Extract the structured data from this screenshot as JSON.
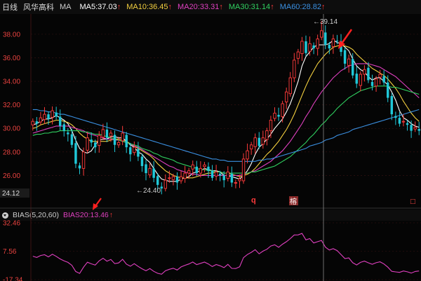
{
  "header": {
    "period": "日线",
    "stock_name": "风华高科",
    "indicator": "MA",
    "ma": [
      {
        "label": "MA5:37.03",
        "color": "#ffffff"
      },
      {
        "label": "MA10:36.45",
        "color": "#f4d03f"
      },
      {
        "label": "MA20:33.31",
        "color": "#e040c0"
      },
      {
        "label": "MA30:31.14",
        "color": "#30d060"
      },
      {
        "label": "MA60:28.82",
        "color": "#3a8fe0"
      }
    ],
    "up_arrow": "↑"
  },
  "sub_header": {
    "indicator": "BIAS(5,20,60)",
    "value": "BIAS20:13.46",
    "color": "#e040c0"
  },
  "annotations": {
    "high_label": "39.14",
    "low_label": "24.40",
    "low_axis_value": "24.12",
    "marker_q": "q",
    "marker_rong": "榕",
    "marker_box": "□"
  },
  "colors": {
    "up": "#ff3b3b",
    "down": "#20c8d8",
    "grid": "#3a1414",
    "axis": "#e8423f"
  },
  "chart_data": [
    {
      "type": "candlestick",
      "ylim": [
        24.12,
        39.6
      ],
      "yticks": [
        38.0,
        36.0,
        34.0,
        32.0,
        30.0,
        28.0,
        26.0
      ],
      "high": 39.14,
      "low": 24.4,
      "close": [
        30.6,
        30.4,
        30.9,
        31.2,
        30.8,
        31.5,
        31.0,
        30.2,
        29.8,
        29.5,
        28.6,
        27.0,
        26.6,
        28.0,
        29.2,
        28.8,
        28.4,
        29.4,
        29.9,
        29.2,
        29.6,
        28.6,
        28.8,
        29.6,
        28.4,
        27.8,
        28.4,
        27.6,
        26.8,
        26.2,
        26.6,
        25.8,
        25.2,
        24.9,
        25.6,
        25.8,
        25.9,
        25.4,
        25.9,
        26.2,
        26.4,
        26.9,
        26.2,
        26.6,
        26.9,
        26.4,
        25.8,
        26.3,
        26.0,
        25.6,
        26.3,
        25.4,
        25.4,
        25.7,
        27.4,
        28.1,
        28.6,
        29.2,
        28.5,
        29.2,
        29.8,
        30.7,
        31.3,
        31.0,
        32.1,
        33.1,
        34.3,
        35.8,
        36.5,
        37.4,
        36.4,
        37.2,
        36.8,
        37.6,
        38.3,
        37.1,
        36.8,
        37.6,
        37.4,
        36.5,
        35.5,
        35.9,
        34.5,
        33.8,
        34.6,
        35.0,
        34.1,
        33.6,
        34.2,
        34.6,
        33.9,
        32.6,
        31.2,
        30.9,
        30.4,
        30.6,
        30.3,
        29.8,
        30.1,
        29.8
      ],
      "series": [
        {
          "name": "MA5",
          "color": "#ffffff",
          "values": [
            30.3,
            30.4,
            30.6,
            30.8,
            30.8,
            30.9,
            31.1,
            30.9,
            30.7,
            30.4,
            29.8,
            29.0,
            28.3,
            28.0,
            27.9,
            28.1,
            28.6,
            29.0,
            29.1,
            29.1,
            29.3,
            29.3,
            29.2,
            29.2,
            28.9,
            28.6,
            28.4,
            28.0,
            27.8,
            27.4,
            27.1,
            26.6,
            26.1,
            25.7,
            25.6,
            25.5,
            25.5,
            25.5,
            25.7,
            25.8,
            25.9,
            26.2,
            26.3,
            26.4,
            26.6,
            26.5,
            26.4,
            26.4,
            26.3,
            26.0,
            26.0,
            25.9,
            25.8,
            25.7,
            26.0,
            26.4,
            27.0,
            27.8,
            28.4,
            28.7,
            29.1,
            29.5,
            30.0,
            30.4,
            30.8,
            31.4,
            32.1,
            33.0,
            34.0,
            35.3,
            36.1,
            36.5,
            36.9,
            37.1,
            37.1,
            37.1,
            37.2,
            37.5,
            37.3,
            37.2,
            36.9,
            36.6,
            35.9,
            35.3,
            35.0,
            34.8,
            34.4,
            34.1,
            34.3,
            34.3,
            34.0,
            33.7,
            33.1,
            32.4,
            31.5,
            30.9,
            30.7,
            30.4,
            30.2,
            30.1
          ]
        },
        {
          "name": "MA10",
          "color": "#f4d03f",
          "values": [
            30.0,
            30.1,
            30.3,
            30.4,
            30.5,
            30.6,
            30.7,
            30.7,
            30.6,
            30.5,
            30.3,
            30.0,
            29.6,
            29.3,
            29.1,
            28.9,
            28.9,
            28.9,
            28.9,
            28.9,
            29.0,
            29.1,
            29.1,
            29.0,
            28.9,
            28.7,
            28.5,
            28.3,
            28.1,
            27.9,
            27.7,
            27.4,
            27.0,
            26.7,
            26.4,
            26.2,
            26.0,
            25.9,
            25.8,
            25.8,
            25.8,
            25.8,
            25.9,
            26.0,
            26.1,
            26.2,
            26.2,
            26.3,
            26.3,
            26.2,
            26.2,
            26.1,
            26.0,
            25.9,
            26.0,
            26.1,
            26.3,
            26.6,
            27.0,
            27.4,
            27.8,
            28.1,
            28.5,
            28.9,
            29.4,
            29.9,
            30.5,
            31.2,
            32.0,
            32.8,
            33.6,
            34.3,
            34.9,
            35.5,
            35.9,
            36.3,
            36.6,
            36.9,
            37.0,
            37.1,
            37.0,
            36.9,
            36.7,
            36.3,
            36.0,
            35.7,
            35.4,
            35.1,
            34.9,
            34.7,
            34.5,
            34.2,
            33.8,
            33.4,
            32.9,
            32.3,
            31.8,
            31.3,
            30.9,
            30.6
          ]
        },
        {
          "name": "MA20",
          "color": "#e040c0",
          "values": [
            29.6,
            29.7,
            29.8,
            29.9,
            30.0,
            30.1,
            30.2,
            30.2,
            30.2,
            30.2,
            30.1,
            30.0,
            29.9,
            29.8,
            29.6,
            29.5,
            29.4,
            29.3,
            29.2,
            29.1,
            29.1,
            29.0,
            29.0,
            28.9,
            28.8,
            28.7,
            28.5,
            28.4,
            28.2,
            28.0,
            27.8,
            27.6,
            27.4,
            27.2,
            27.0,
            26.8,
            26.7,
            26.5,
            26.4,
            26.3,
            26.2,
            26.1,
            26.1,
            26.0,
            26.0,
            26.0,
            26.0,
            26.0,
            26.0,
            26.0,
            26.0,
            26.0,
            26.0,
            26.0,
            26.1,
            26.2,
            26.3,
            26.4,
            26.6,
            26.8,
            27.0,
            27.2,
            27.5,
            27.8,
            28.1,
            28.5,
            28.9,
            29.4,
            29.9,
            30.4,
            31.0,
            31.5,
            32.1,
            32.6,
            33.1,
            33.5,
            33.9,
            34.3,
            34.6,
            34.9,
            35.1,
            35.3,
            35.4,
            35.5,
            35.5,
            35.5,
            35.5,
            35.4,
            35.3,
            35.2,
            35.0,
            34.8,
            34.6,
            34.4,
            34.1,
            33.8,
            33.5,
            33.2,
            32.9,
            32.6
          ]
        },
        {
          "name": "MA30",
          "color": "#30d060",
          "values": [
            29.4,
            29.5,
            29.5,
            29.6,
            29.6,
            29.7,
            29.7,
            29.8,
            29.8,
            29.8,
            29.8,
            29.8,
            29.8,
            29.7,
            29.7,
            29.6,
            29.5,
            29.5,
            29.4,
            29.3,
            29.2,
            29.1,
            29.0,
            28.9,
            28.8,
            28.7,
            28.6,
            28.5,
            28.3,
            28.2,
            28.1,
            27.9,
            27.8,
            27.6,
            27.5,
            27.4,
            27.3,
            27.1,
            27.0,
            26.9,
            26.8,
            26.7,
            26.6,
            26.5,
            26.5,
            26.4,
            26.4,
            26.3,
            26.3,
            26.2,
            26.2,
            26.2,
            26.2,
            26.2,
            26.2,
            26.2,
            26.3,
            26.3,
            26.4,
            26.5,
            26.6,
            26.7,
            26.8,
            27.0,
            27.2,
            27.4,
            27.6,
            27.9,
            28.2,
            28.5,
            28.8,
            29.2,
            29.5,
            29.9,
            30.3,
            30.6,
            31.0,
            31.3,
            31.7,
            32.0,
            32.3,
            32.6,
            32.8,
            33.0,
            33.2,
            33.3,
            33.4,
            33.5,
            33.6,
            33.6,
            33.6,
            33.6,
            33.5,
            33.5,
            33.4,
            33.3,
            33.2,
            33.1,
            33.0,
            32.9
          ]
        },
        {
          "name": "MA60",
          "color": "#3a8fe0",
          "values": [
            31.6,
            31.6,
            31.5,
            31.5,
            31.4,
            31.4,
            31.3,
            31.2,
            31.2,
            31.1,
            31.0,
            30.9,
            30.8,
            30.7,
            30.6,
            30.5,
            30.4,
            30.3,
            30.2,
            30.1,
            30.0,
            29.9,
            29.8,
            29.7,
            29.6,
            29.5,
            29.4,
            29.3,
            29.2,
            29.1,
            29.0,
            28.9,
            28.8,
            28.7,
            28.6,
            28.5,
            28.4,
            28.3,
            28.2,
            28.1,
            28.0,
            27.9,
            27.8,
            27.7,
            27.6,
            27.5,
            27.4,
            27.4,
            27.3,
            27.3,
            27.2,
            27.2,
            27.2,
            27.2,
            27.2,
            27.2,
            27.2,
            27.2,
            27.3,
            27.3,
            27.4,
            27.4,
            27.5,
            27.6,
            27.7,
            27.8,
            27.9,
            28.0,
            28.1,
            28.2,
            28.3,
            28.5,
            28.6,
            28.7,
            28.8,
            29.0,
            29.1,
            29.2,
            29.4,
            29.5,
            29.6,
            29.7,
            29.9,
            30.0,
            30.1,
            30.2,
            30.3,
            30.4,
            30.5,
            30.6,
            30.7,
            30.8,
            30.9,
            31.0,
            31.1,
            31.2,
            31.3,
            31.4,
            31.5,
            31.6
          ]
        }
      ]
    },
    {
      "type": "line",
      "ylim": [
        -17.34,
        32.46
      ],
      "yticks": [
        32.46,
        7.56,
        -17.34
      ],
      "series": [
        {
          "name": "BIAS20",
          "color": "#e040c0",
          "values": [
            3.2,
            2.1,
            3.8,
            4.5,
            2.6,
            4.9,
            3.1,
            0.8,
            -0.9,
            -2.2,
            -4.8,
            -10.2,
            -11.9,
            -6.4,
            -2.1,
            -3.5,
            -4.6,
            -0.9,
            1.4,
            -1.2,
            0.3,
            -3.3,
            -2.7,
            0.5,
            -3.8,
            -5.6,
            -3.4,
            -5.8,
            -7.9,
            -9.6,
            -7.7,
            -10.1,
            -11.8,
            -12.6,
            -9.6,
            -8.3,
            -7.4,
            -8.9,
            -6.2,
            -4.8,
            -3.6,
            -1.9,
            -4.2,
            -3.1,
            -2.0,
            -3.6,
            -5.9,
            -4.1,
            -5.2,
            -6.8,
            -4.0,
            -7.5,
            -7.6,
            -6.1,
            1.9,
            4.7,
            6.6,
            8.9,
            5.3,
            7.6,
            9.3,
            12.1,
            13.2,
            11.0,
            13.7,
            15.9,
            18.6,
            21.8,
            21.9,
            23.2,
            17.5,
            18.6,
            14.8,
            15.9,
            17.0,
            11.1,
            8.6,
            9.8,
            8.1,
            4.6,
            1.1,
            1.7,
            -2.5,
            -4.5,
            -2.2,
            -1.1,
            -2.6,
            -3.9,
            -2.5,
            -1.7,
            -3.6,
            -6.4,
            -10.1,
            -10.6,
            -11.0,
            -9.8,
            -10.5,
            -11.6,
            -10.2,
            -9.8
          ]
        }
      ]
    }
  ]
}
